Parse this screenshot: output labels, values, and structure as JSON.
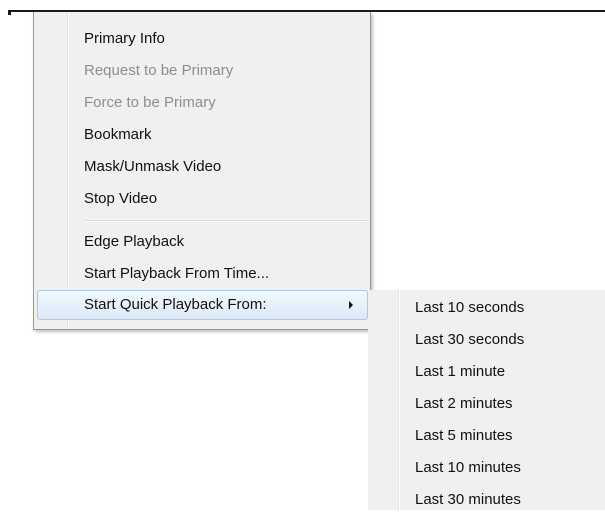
{
  "context_menu": {
    "items": [
      {
        "label": "Primary Info",
        "enabled": true
      },
      {
        "label": "Request to be Primary",
        "enabled": false
      },
      {
        "label": "Force to be Primary",
        "enabled": false
      },
      {
        "label": "Bookmark",
        "enabled": true
      },
      {
        "label": "Mask/Unmask Video",
        "enabled": true
      },
      {
        "label": "Stop Video",
        "enabled": true
      },
      {
        "label": "Edge Playback",
        "enabled": true
      },
      {
        "label": "Start Playback From Time...",
        "enabled": true
      },
      {
        "label": "Start Quick Playback From:",
        "enabled": true,
        "has_submenu": true,
        "highlighted": true
      }
    ]
  },
  "quick_playback_submenu": {
    "items": [
      {
        "label": "Last 10 seconds"
      },
      {
        "label": "Last 30 seconds"
      },
      {
        "label": "Last 1 minute"
      },
      {
        "label": "Last 2 minutes"
      },
      {
        "label": "Last 5 minutes"
      },
      {
        "label": "Last 10 minutes"
      },
      {
        "label": "Last 30 minutes"
      }
    ]
  },
  "colors": {
    "menu_background": "#f0f0f0",
    "disabled_text": "#8d8d8d",
    "highlight_border": "#a8c7ee"
  }
}
